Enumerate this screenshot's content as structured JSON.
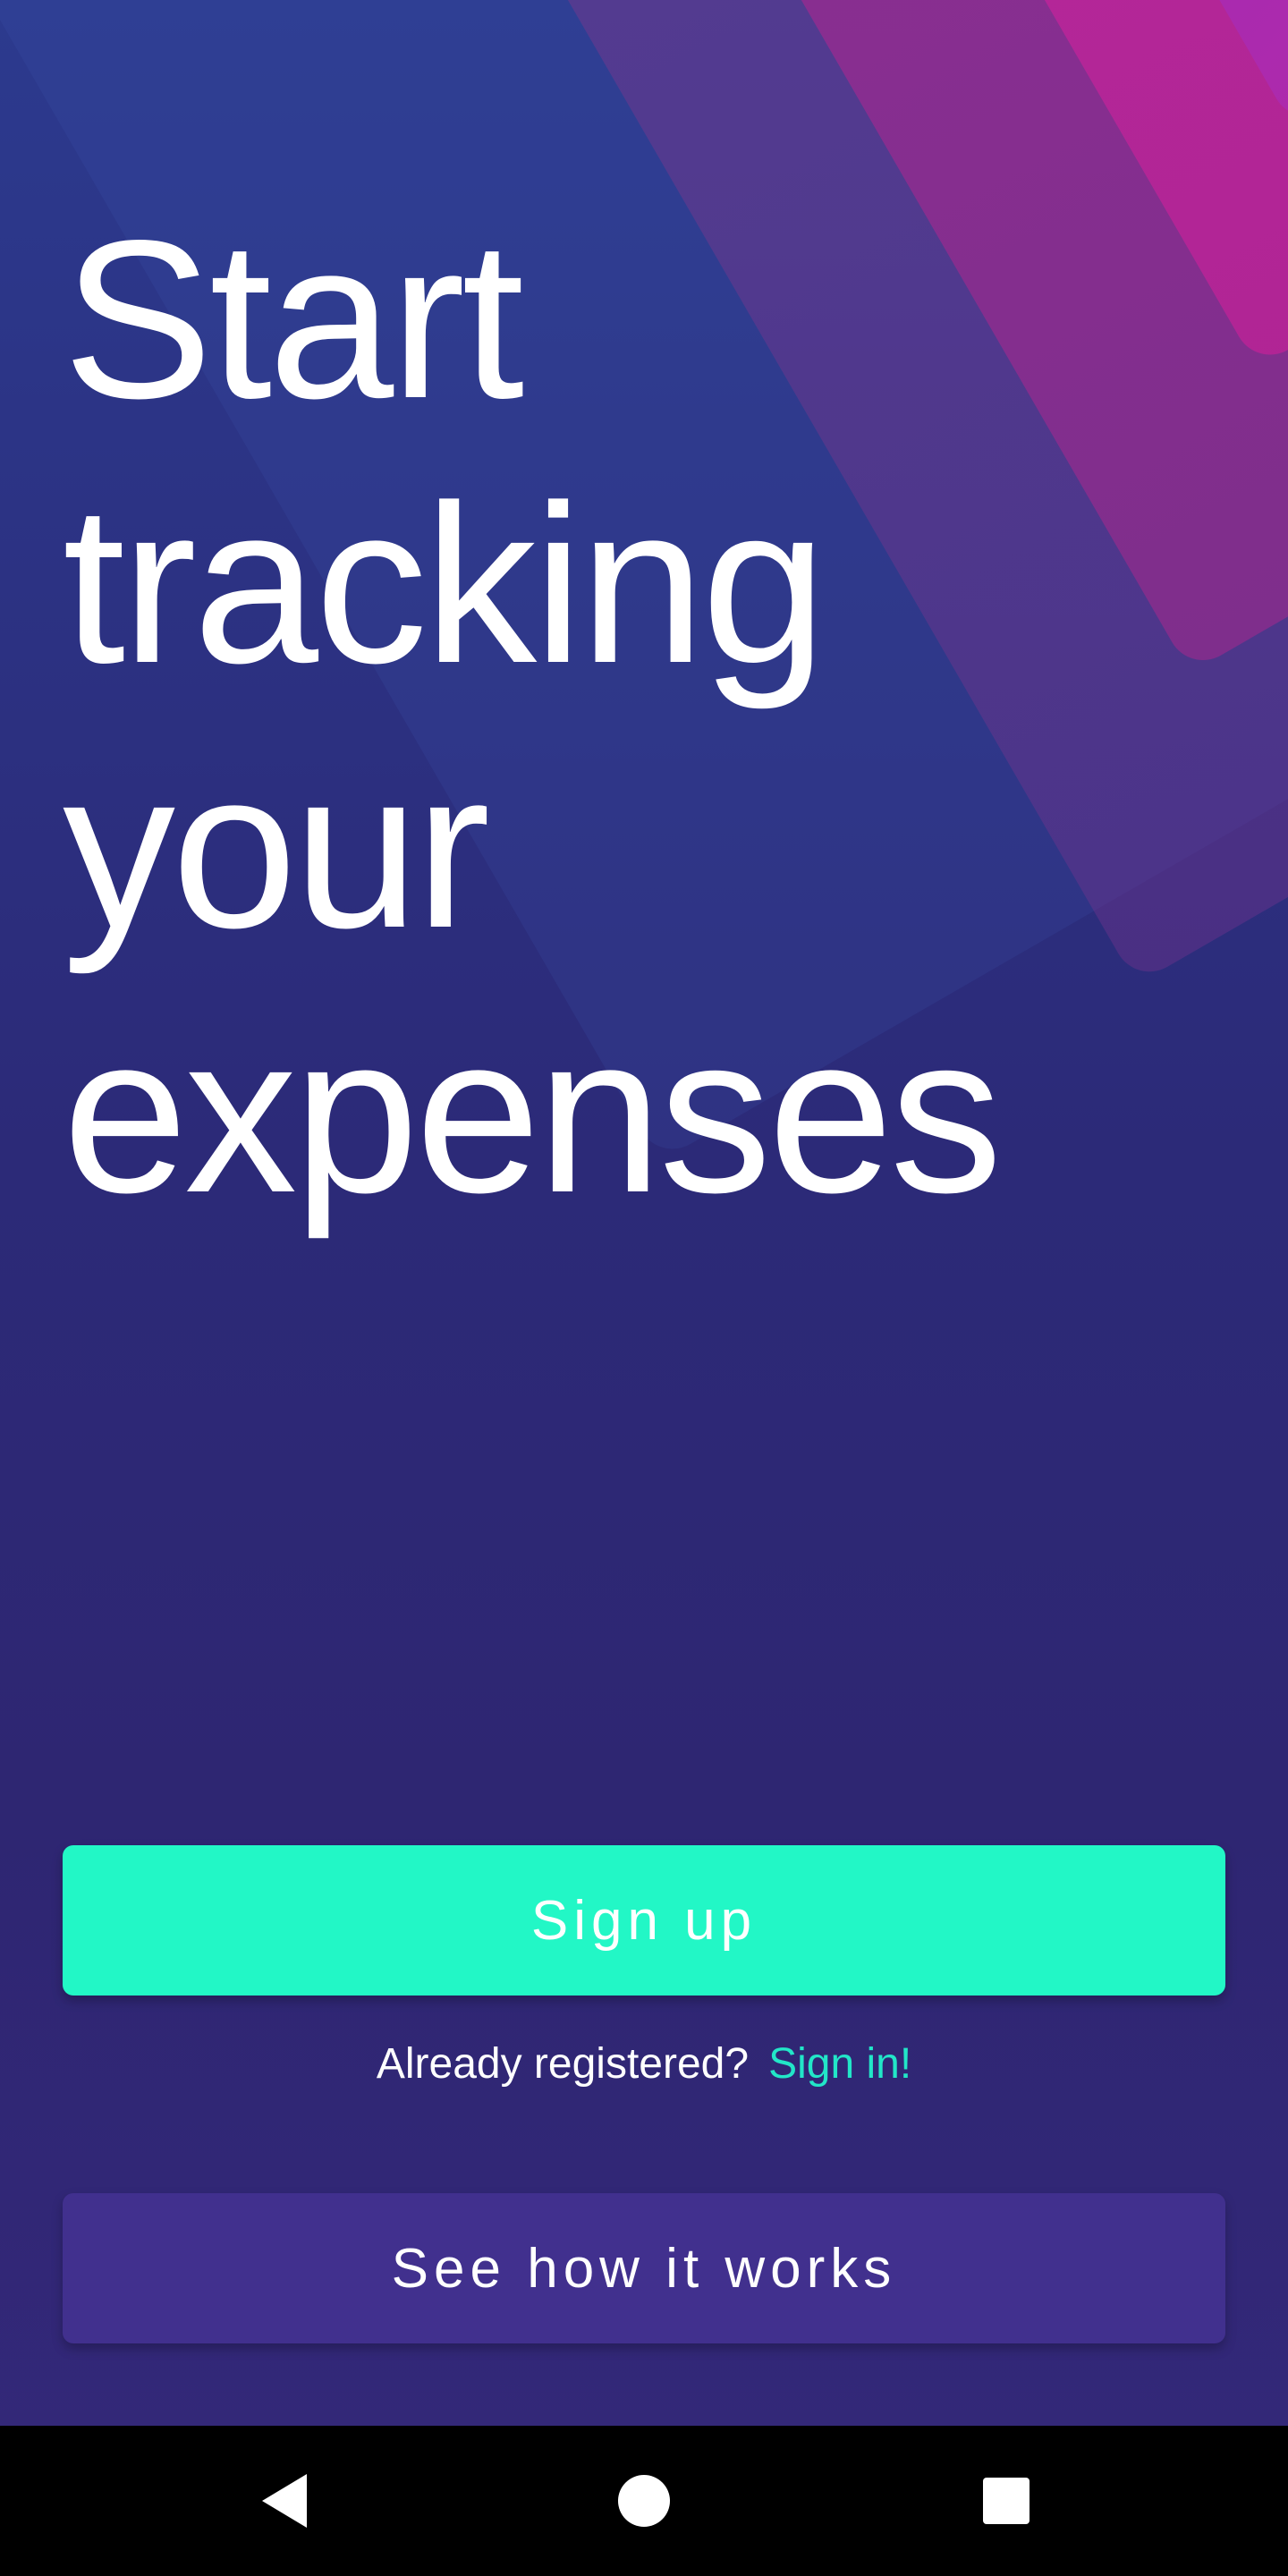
{
  "hero": {
    "headline_lines": [
      "Start",
      "tracking",
      "your",
      "expenses"
    ]
  },
  "actions": {
    "signup_label": "Sign up",
    "already_registered_text": "Already registered?",
    "signin_link_label": "Sign in!",
    "how_it_works_label": "See how it works"
  },
  "nav_bar": {
    "back_icon": "back-triangle-icon",
    "home_icon": "home-circle-icon",
    "recents_icon": "recents-square-icon"
  },
  "colors": {
    "primary_accent": "#22f7c6",
    "link_accent": "#22e6c8",
    "secondary_button": "#41308e",
    "background": "#2c2a78",
    "ribbon_magenta": "#b8249a"
  }
}
